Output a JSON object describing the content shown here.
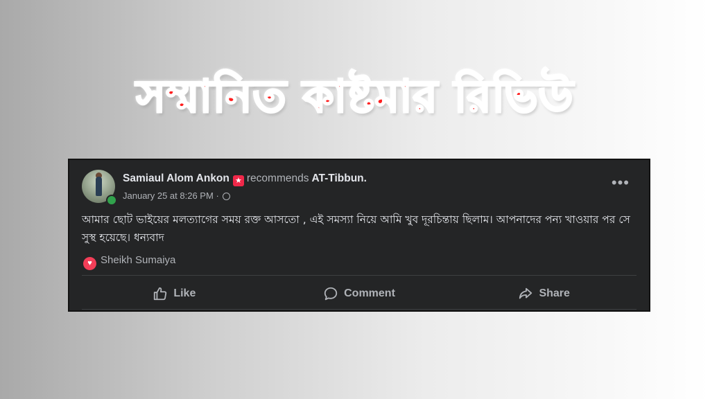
{
  "banner": {
    "title": "সম্মানিত কাষ্টমার রিভিউ"
  },
  "post": {
    "author": "Samiaul Alom Ankon",
    "action_text": "recommends",
    "page_name": "AT-Tibbun.",
    "date": "January 25 at 8:26 PM",
    "separator": "·",
    "more_label": "•••",
    "text": "আমার ছোট ভাইয়ের মলত্যাগের সময় রক্ত আসতো , এই সমস্যা নিয়ে আমি খুব দূরচিন্তায় ছিলাম। আপনাদের পন্য খাওয়ার পর সে সুস্থ হয়েছে। ধন্যবাদ",
    "reactor": "Sheikh Sumaiya",
    "actions": {
      "like": "Like",
      "comment": "Comment",
      "share": "Share"
    }
  },
  "colors": {
    "headline": "#ff1f1f",
    "card_bg": "#242526",
    "reaction": "#f33e58",
    "online": "#31a24c",
    "badge": "#f02849"
  },
  "icons": [
    "avatar",
    "recommend-badge-icon",
    "globe-icon",
    "more-options-icon",
    "heart-reaction-icon",
    "like-icon",
    "comment-icon",
    "share-icon"
  ]
}
